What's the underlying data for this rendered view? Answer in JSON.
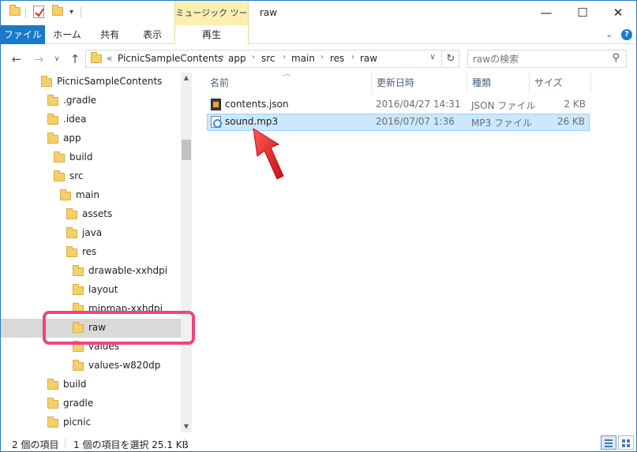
{
  "titlebar": {
    "context_tab_head": "ミュージック ツール",
    "title": "raw",
    "minimize": "—",
    "maximize": "☐",
    "close": "✕"
  },
  "ribbon": {
    "tabs": [
      {
        "label": "ファイル"
      },
      {
        "label": "ホーム"
      },
      {
        "label": "共有"
      },
      {
        "label": "表示"
      },
      {
        "label": "再生"
      }
    ]
  },
  "address": {
    "overflow": "«",
    "segments": [
      "PicnicSampleContents",
      "app",
      "src",
      "main",
      "res",
      "raw"
    ],
    "search_placeholder": "rawの検索"
  },
  "nav": {
    "items": [
      {
        "label": "PicnicSampleContents",
        "level": 0
      },
      {
        "label": ".gradle",
        "level": 1
      },
      {
        "label": ".idea",
        "level": 1
      },
      {
        "label": "app",
        "level": 1
      },
      {
        "label": "build",
        "level": 2
      },
      {
        "label": "src",
        "level": 2
      },
      {
        "label": "main",
        "level": 3
      },
      {
        "label": "assets",
        "level": 4
      },
      {
        "label": "java",
        "level": 4
      },
      {
        "label": "res",
        "level": 4
      },
      {
        "label": "drawable-xxhdpi",
        "level": 5
      },
      {
        "label": "layout",
        "level": 5
      },
      {
        "label": "mipmap-xxhdpi",
        "level": 5
      },
      {
        "label": "raw",
        "level": 5,
        "selected": true
      },
      {
        "label": "values",
        "level": 5
      },
      {
        "label": "values-w820dp",
        "level": 5
      },
      {
        "label": "build",
        "level": 1
      },
      {
        "label": "gradle",
        "level": 1
      },
      {
        "label": "picnic",
        "level": 1
      }
    ]
  },
  "columns": {
    "name": "名前",
    "date": "更新日時",
    "type": "種類",
    "size": "サイズ"
  },
  "files": [
    {
      "name": "contents.json",
      "date": "2016/04/27 14:31",
      "type": "JSON ファイル",
      "size": "2 KB",
      "icon": "json-file-icon"
    },
    {
      "name": "sound.mp3",
      "date": "2016/07/07 1:36",
      "type": "MP3 ファイル",
      "size": "26 KB",
      "icon": "mp3-file-icon",
      "selected": true
    }
  ],
  "status": {
    "item_count": "2 個の項目",
    "selection": "1 個の項目を選択  25.1 KB"
  },
  "colors": {
    "accent": "#1979ca",
    "selection": "#cce8ff",
    "highlight_box": "#f0457c",
    "arrow": "#e8202a"
  }
}
